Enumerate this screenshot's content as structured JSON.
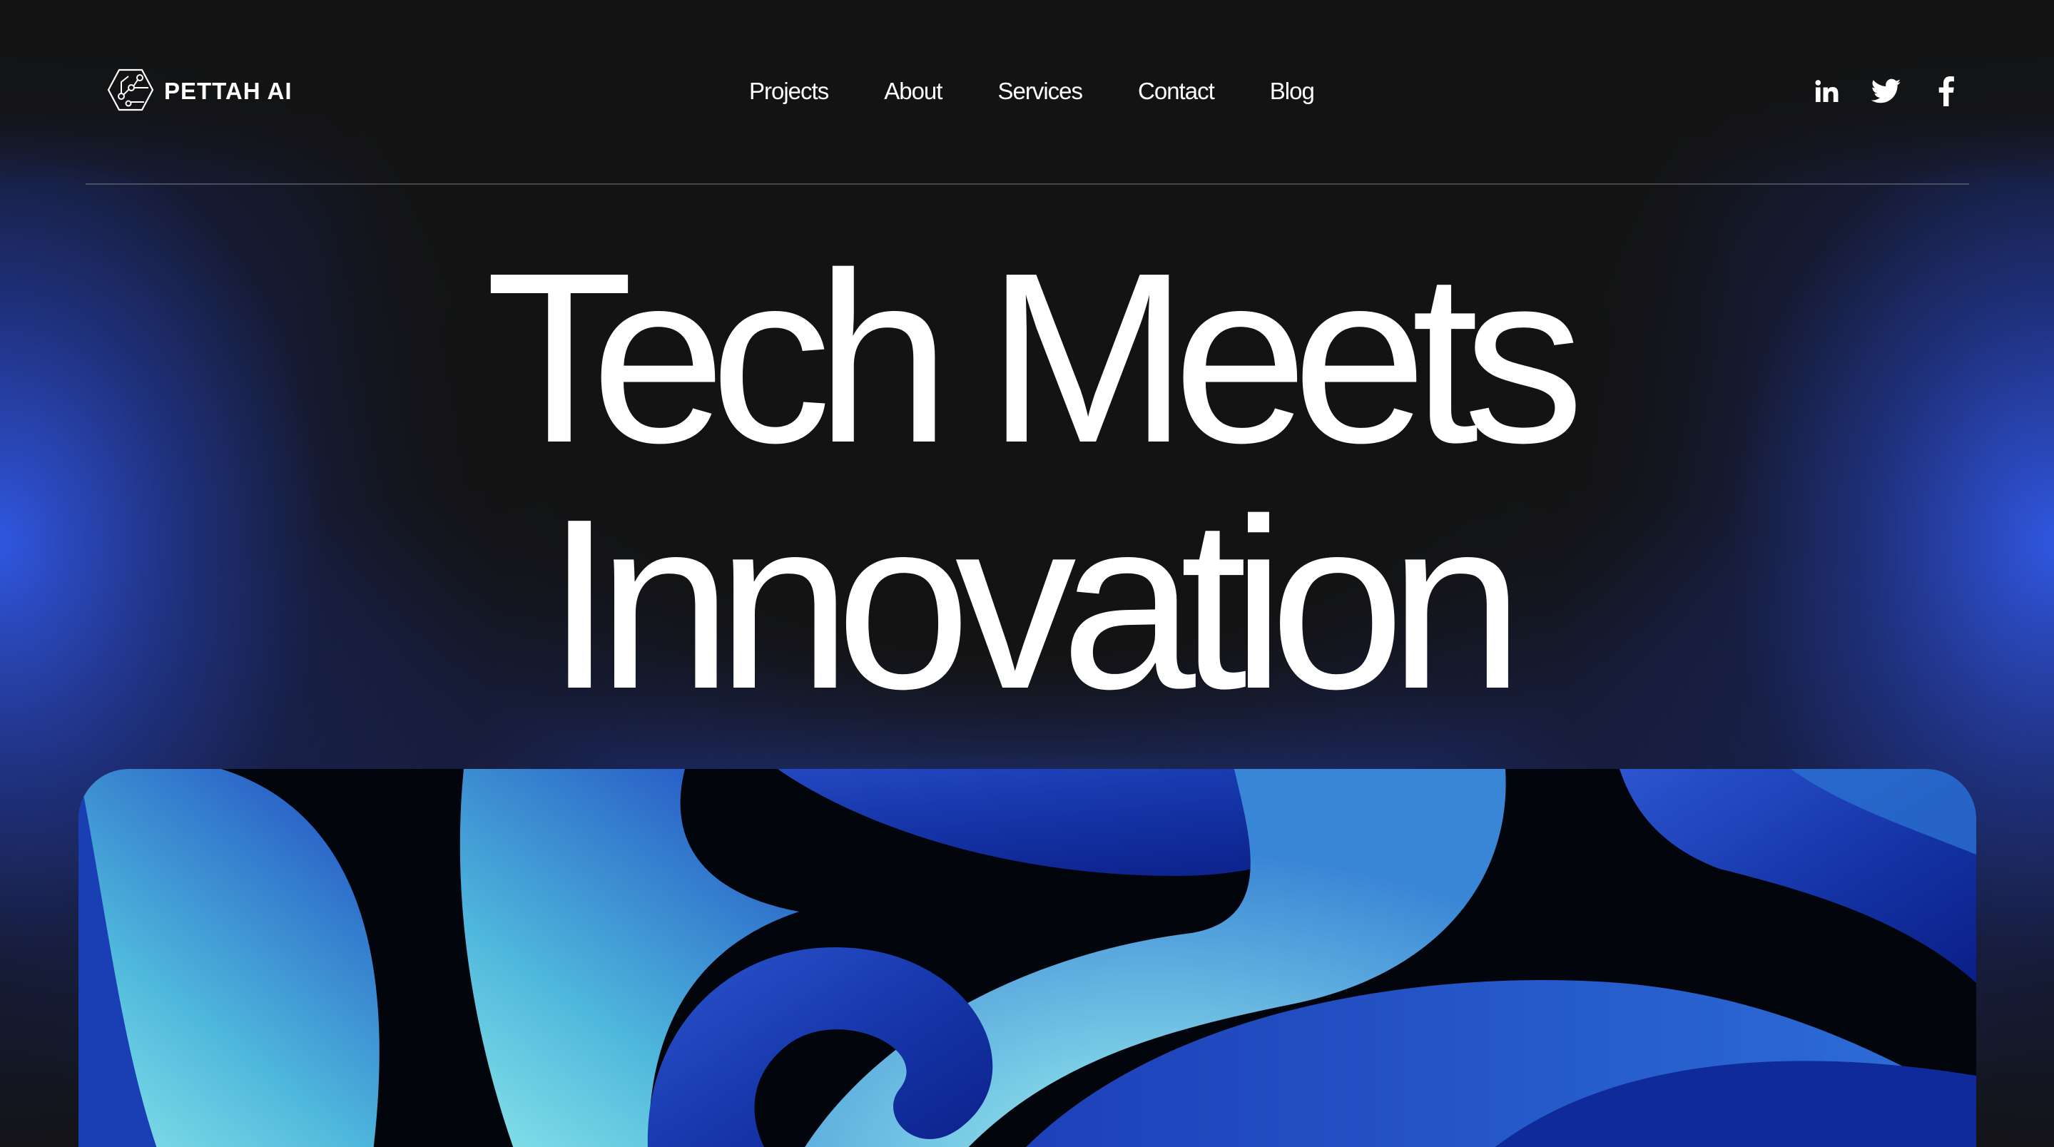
{
  "brand": {
    "name": "PETTAH AI",
    "logo_icon": "circuit-hexagon-icon"
  },
  "nav": {
    "items": [
      {
        "label": "Projects"
      },
      {
        "label": "About"
      },
      {
        "label": "Services"
      },
      {
        "label": "Contact"
      },
      {
        "label": "Blog"
      }
    ]
  },
  "socials": [
    {
      "icon": "linkedin-icon"
    },
    {
      "icon": "twitter-icon"
    },
    {
      "icon": "facebook-icon"
    }
  ],
  "hero": {
    "headline_line1": "Tech Meets",
    "headline_line2": "Innovation",
    "image_icon": "abstract-blue-ribbons-image"
  },
  "colors": {
    "background": "#131313",
    "accent_blue": "#2f55e6",
    "ribbon_light": "#7fe3ea",
    "ribbon_dark": "#0d1f8c",
    "text": "#ffffff"
  }
}
